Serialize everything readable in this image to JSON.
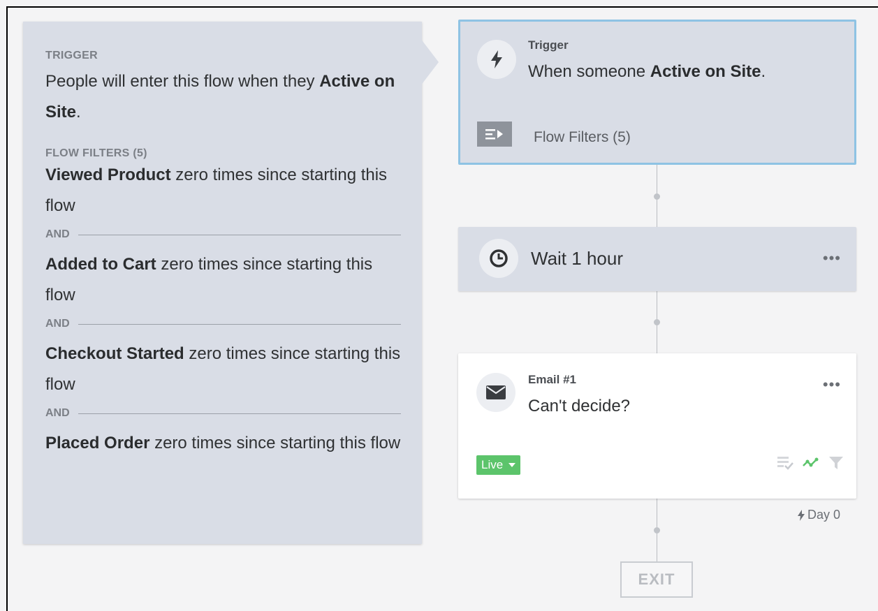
{
  "details_panel": {
    "trigger_section_label": "TRIGGER",
    "trigger_text_prefix": "People will enter this flow when they ",
    "trigger_event": "Active on Site",
    "trigger_text_suffix": ".",
    "filters_section_label": "FLOW FILTERS (5)",
    "and_label": "AND",
    "filters": [
      {
        "event": "Viewed Product",
        "condition": " zero times since starting this flow"
      },
      {
        "event": "Added to Cart",
        "condition": " zero times since starting this flow"
      },
      {
        "event": "Checkout Started",
        "condition": " zero times since starting this flow"
      },
      {
        "event": "Placed Order",
        "condition": " zero times since starting this flow"
      }
    ]
  },
  "trigger_card": {
    "label": "Trigger",
    "desc_prefix": "When someone ",
    "desc_event": "Active on Site",
    "desc_suffix": ".",
    "filters_text": "Flow Filters (5)",
    "icon": "lightning-icon"
  },
  "wait_card": {
    "text": "Wait 1 hour",
    "icon": "clock-icon",
    "menu": "•••"
  },
  "email_card": {
    "label": "Email #1",
    "subject": "Can't decide?",
    "menu": "•••",
    "status": "Live",
    "icon": "envelope-icon"
  },
  "day_label": "Day 0",
  "exit_label": "EXIT",
  "colors": {
    "card_bg": "#d9dde6",
    "selected_border": "#8ec3e4",
    "live_green": "#5cc46b"
  }
}
